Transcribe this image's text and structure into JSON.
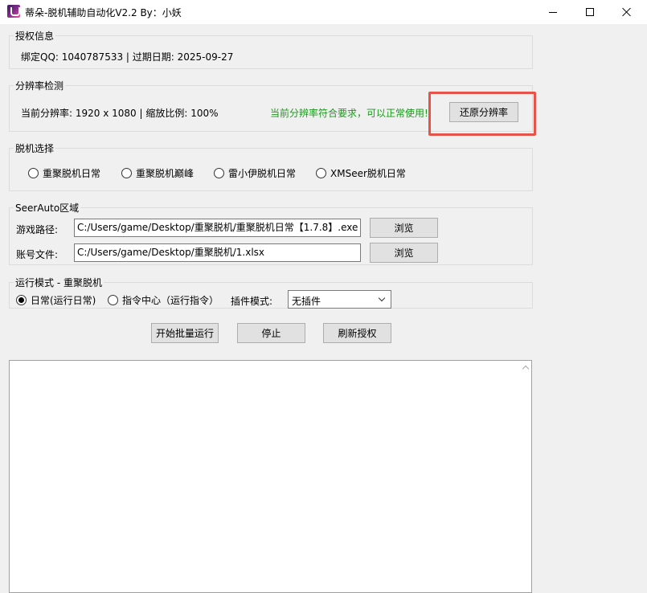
{
  "window": {
    "title": "蒂朵-脱机辅助自动化V2.2 By：小妖"
  },
  "auth": {
    "legend": "授权信息",
    "text": "绑定QQ: 1040787533 | 过期日期: 2025-09-27"
  },
  "resolution": {
    "legend": "分辨率检测",
    "current": "当前分辨率: 1920 x 1080 | 缩放比例: 100%",
    "status": "当前分辨率符合要求，可以正常使用!",
    "restore_label": "还原分辨率",
    "status_color": "#1a9a1a",
    "highlight_color": "#e5534b"
  },
  "mode_select": {
    "legend": "脱机选择",
    "options": [
      {
        "label": "重聚脱机日常",
        "selected": false
      },
      {
        "label": "重聚脱机巅峰",
        "selected": false
      },
      {
        "label": "雷小伊脱机日常",
        "selected": false
      },
      {
        "label": "XMSeer脱机日常",
        "selected": false
      }
    ]
  },
  "seerauto": {
    "legend": "SeerAuto区域",
    "game_path_label": "游戏路径:",
    "game_path_value": "C:/Users/game/Desktop/重聚脱机/重聚脱机日常【1.7.8】.exe",
    "account_file_label": "账号文件:",
    "account_file_value": "C:/Users/game/Desktop/重聚脱机/1.xlsx",
    "browse_label": "浏览"
  },
  "run_mode": {
    "legend": "运行模式 - 重聚脱机",
    "daily_label": "日常(运行日常)",
    "command_label": "指令中心（运行指令）",
    "plugin_label": "插件模式:",
    "plugin_value": "无插件"
  },
  "actions": {
    "start": "开始批量运行",
    "stop": "停止",
    "refresh": "刷新授权"
  },
  "log": {
    "content": ""
  }
}
